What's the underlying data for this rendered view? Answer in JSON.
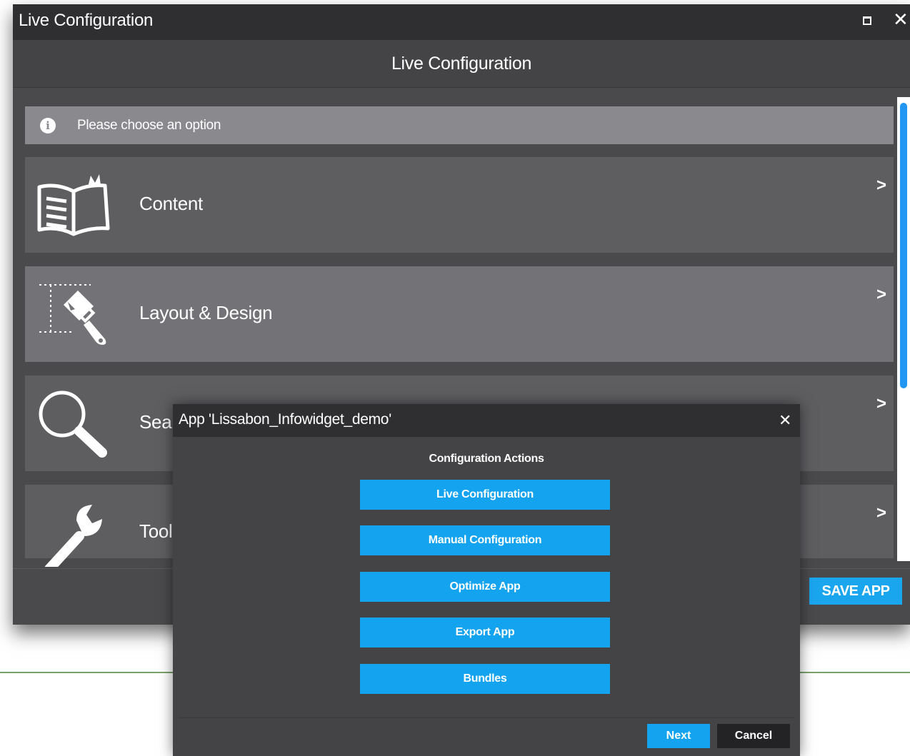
{
  "window": {
    "title": "Live Configuration",
    "header": "Live Configuration",
    "info_text": "Please choose an option",
    "options": [
      {
        "label": "Content",
        "icon": "book-icon"
      },
      {
        "label": "Layout & Design",
        "icon": "paint-brush-icon"
      },
      {
        "label": "Search",
        "icon": "magnifier-icon"
      },
      {
        "label": "Tools",
        "icon": "wrench-icon"
      }
    ],
    "save_label": "SAVE APP"
  },
  "modal": {
    "title": "App 'Lissabon_Infowidget_demo'",
    "section": "Configuration Actions",
    "actions": [
      "Live Configuration",
      "Manual Configuration",
      "Optimize App",
      "Export App",
      "Bundles"
    ],
    "next_label": "Next",
    "cancel_label": "Cancel"
  },
  "colors": {
    "titlebar": "#2f2f31",
    "panel": "#4a4a4c",
    "option": "#5e5e61",
    "option_active": "#737276",
    "accent": "#14a3ef",
    "cancel": "#232325"
  }
}
